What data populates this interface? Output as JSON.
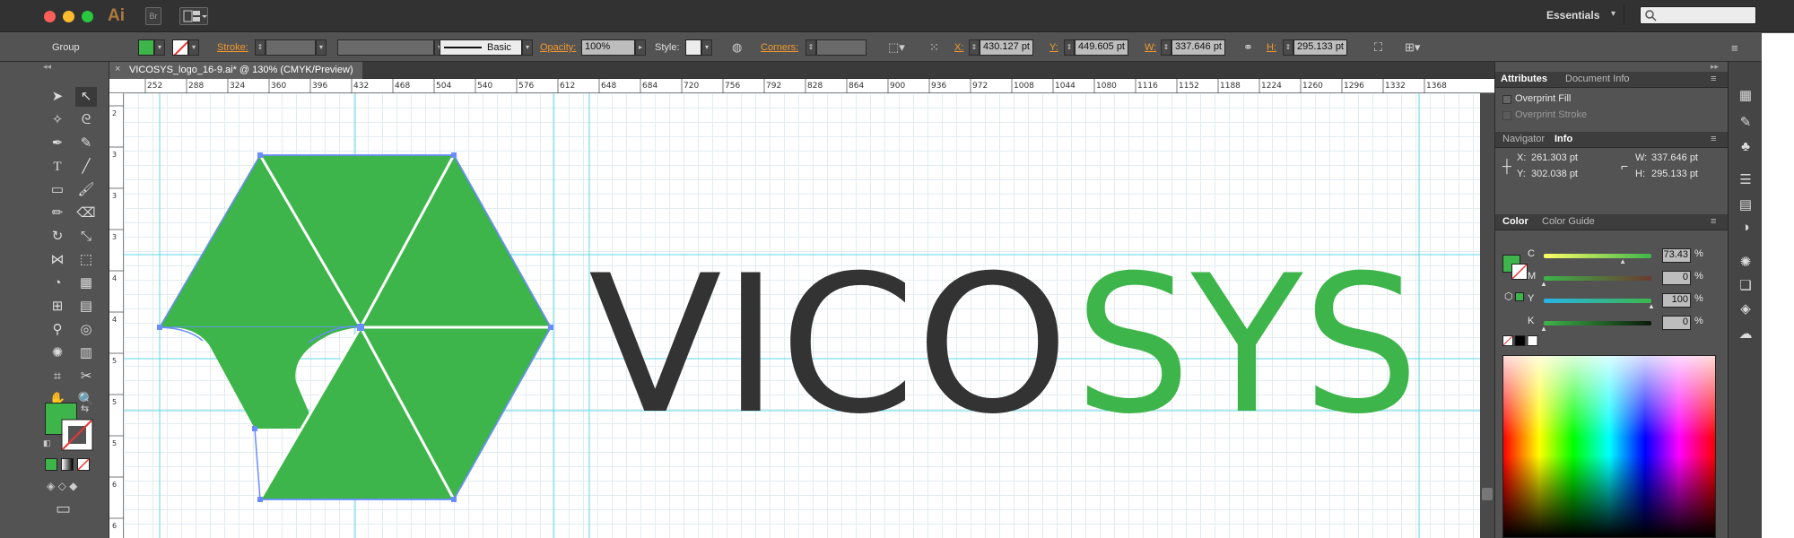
{
  "app": {
    "badge": "Ai",
    "workspace": "Essentials",
    "search_placeholder": ""
  },
  "controlbar": {
    "selection": "Group",
    "stroke_label": "Stroke:",
    "brush_name": "Basic",
    "opacity_label": "Opacity:",
    "opacity_value": "100%",
    "style_label": "Style:",
    "corners_label": "Corners:",
    "x_label": "X:",
    "x_value": "430.127 pt",
    "y_label": "Y:",
    "y_value": "449.605 pt",
    "w_label": "W:",
    "w_value": "337.646 pt",
    "h_label": "H:",
    "h_value": "295.133 pt"
  },
  "document": {
    "tab_title": "VICOSYS_logo_16-9.ai* @ 130% (CMYK/Preview)",
    "ruler_h": [
      "252",
      "288",
      "324",
      "360",
      "396",
      "432",
      "468",
      "504",
      "540",
      "576",
      "612",
      "648",
      "684",
      "720",
      "756",
      "792",
      "828",
      "864",
      "900",
      "936",
      "972",
      "1008",
      "1044",
      "1080",
      "1116",
      "1152",
      "1188",
      "1224",
      "1260",
      "1296",
      "1332",
      "1368"
    ],
    "ruler_v": [
      "2",
      "3",
      "3",
      "3",
      "4",
      "4",
      "5",
      "5",
      "5",
      "6",
      "6"
    ],
    "logo_text_dark": "VICO",
    "logo_text_green": "SYS"
  },
  "panels": {
    "attributes": {
      "tab_active": "Attributes",
      "tab_other": "Document Info",
      "overprint_fill": "Overprint Fill",
      "overprint_stroke": "Overprint Stroke"
    },
    "info": {
      "tab_other": "Navigator",
      "tab_active": "Info",
      "x_label": "X:",
      "x_value": "261.303 pt",
      "y_label": "Y:",
      "y_value": "302.038 pt",
      "w_label": "W:",
      "w_value": "337.646 pt",
      "h_label": "H:",
      "h_value": "295.133 pt"
    },
    "color": {
      "tab_active": "Color",
      "tab_other": "Color Guide",
      "channels": [
        {
          "label": "C",
          "value": "73.43",
          "unit": "%",
          "level": 0.7343
        },
        {
          "label": "M",
          "value": "0",
          "unit": "%",
          "level": 0
        },
        {
          "label": "Y",
          "value": "100",
          "unit": "%",
          "level": 1
        },
        {
          "label": "K",
          "value": "0",
          "unit": "%",
          "level": 0
        }
      ]
    }
  },
  "colors": {
    "brand_green": "#3db54a",
    "logo_dark": "#333333",
    "guide": "#5fd7e6",
    "accent_orange": "#f29a2e"
  }
}
